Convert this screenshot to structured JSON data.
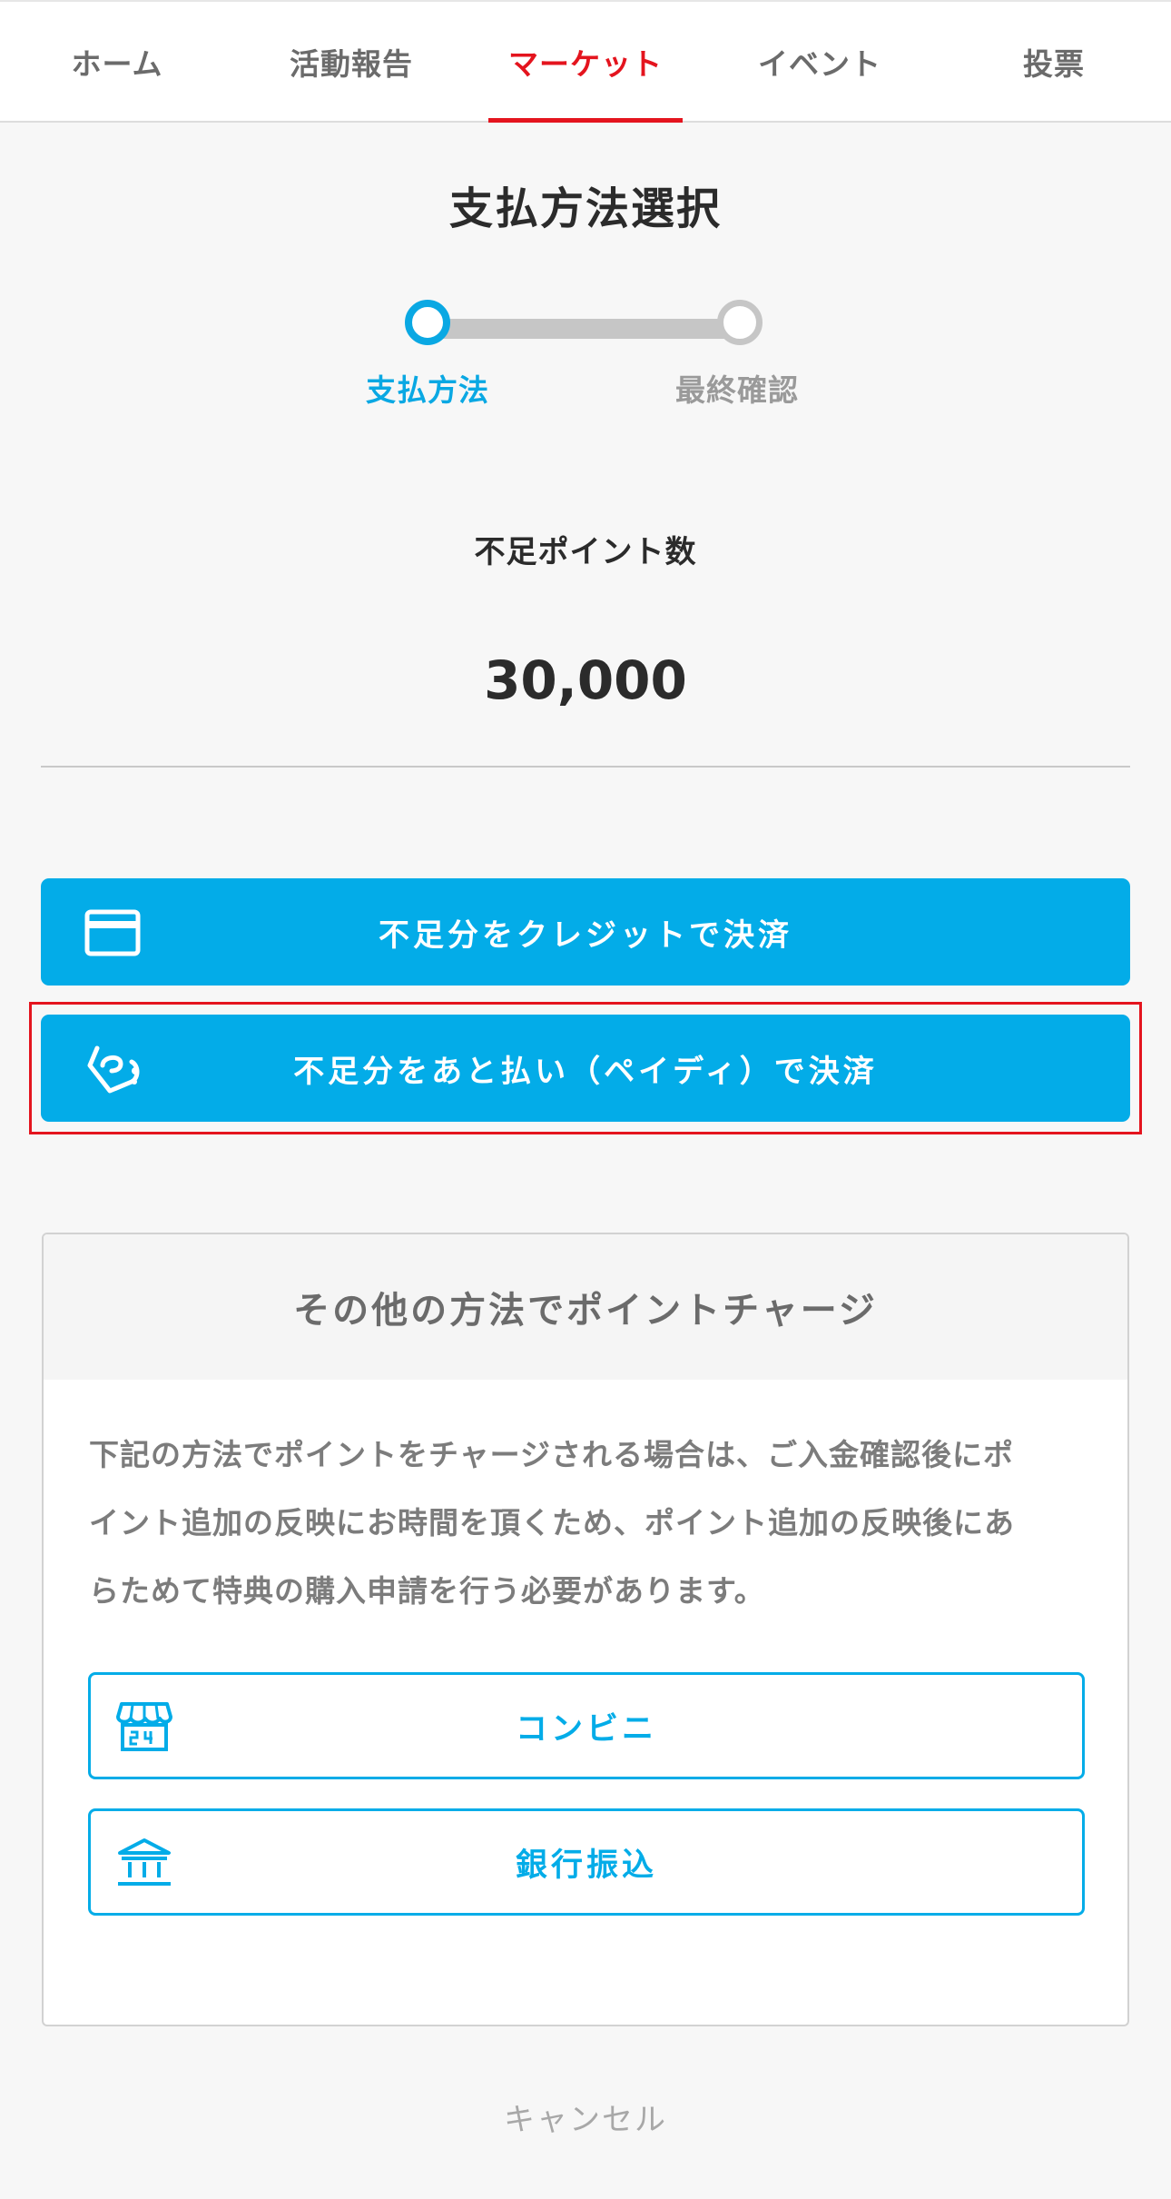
{
  "nav": {
    "tabs": [
      {
        "label": "ホーム",
        "active": false
      },
      {
        "label": "活動報告",
        "active": false
      },
      {
        "label": "マーケット",
        "active": true
      },
      {
        "label": "イベント",
        "active": false
      },
      {
        "label": "投票",
        "active": false
      }
    ]
  },
  "page": {
    "title": "支払方法選択"
  },
  "stepper": {
    "steps": [
      {
        "label": "支払方法",
        "state": "current"
      },
      {
        "label": "最終確認",
        "state": "upcoming"
      }
    ]
  },
  "shortage": {
    "label": "不足ポイント数",
    "value": "30,000"
  },
  "payment": {
    "credit_label": "不足分をクレジットで決済",
    "credit_icon": "credit-card-icon",
    "paidy_label": "不足分をあと払い（ペイディ）で決済",
    "paidy_icon": "paidy-logo-icon"
  },
  "other_methods": {
    "title": "その他の方法でポイントチャージ",
    "description_lines": [
      "下記の方法でポイントをチャージされる場合は、ご入金確認後にポ",
      "イント追加の反映にお時間を頂くため、ポイント追加の反映後にあ",
      "らためて特典の購入申請を行う必要があります。"
    ],
    "konbini_label": "コンビニ",
    "konbini_icon": "convenience-store-icon",
    "bank_label": "銀行振込",
    "bank_icon": "bank-icon"
  },
  "cancel_label": "キャンセル",
  "colors": {
    "accent_blue": "#03ace8",
    "accent_red": "#e4141e",
    "background": "#f7f7f7"
  }
}
